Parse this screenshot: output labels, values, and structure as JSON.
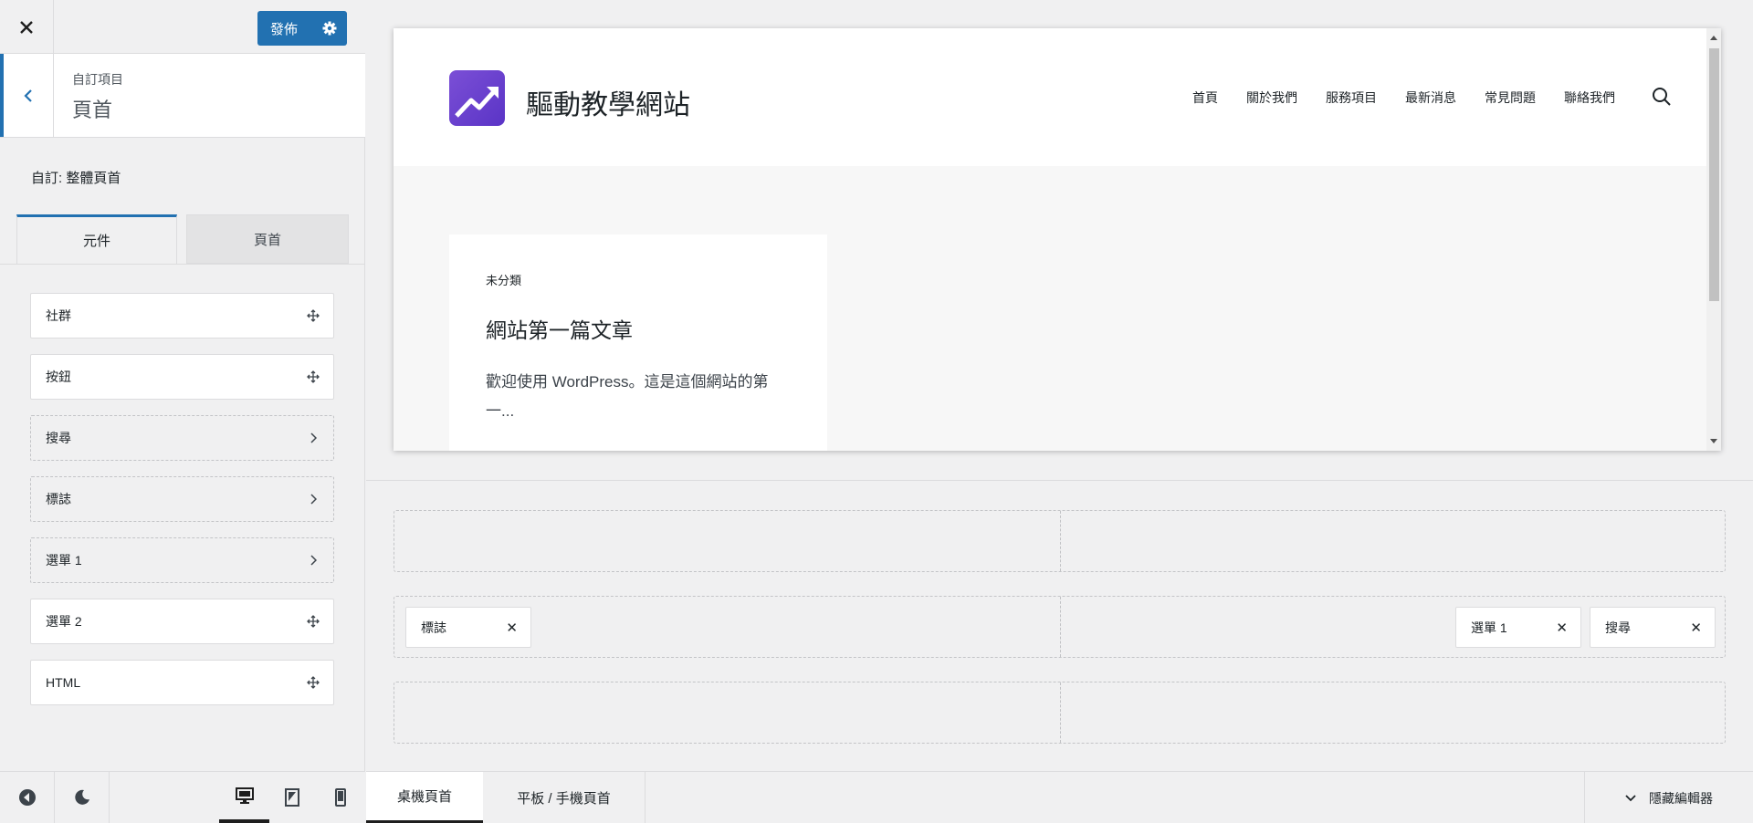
{
  "topbar": {
    "close_icon": "close-icon",
    "publish_label": "發佈"
  },
  "section": {
    "crumb_small": "自訂項目",
    "crumb_title": "頁首"
  },
  "custom_title": "自訂: 整體頁首",
  "tabs": [
    {
      "label": "元件"
    },
    {
      "label": "頁首"
    }
  ],
  "elements": [
    {
      "label": "社群",
      "icon": "move-icon",
      "style": "solid"
    },
    {
      "label": "按鈕",
      "icon": "move-icon",
      "style": "solid"
    },
    {
      "label": "搜尋",
      "icon": "chevron-right-icon",
      "style": "dashed"
    },
    {
      "label": "標誌",
      "icon": "chevron-right-icon",
      "style": "dashed"
    },
    {
      "label": "選單 1",
      "icon": "chevron-right-icon",
      "style": "dashed"
    },
    {
      "label": "選單 2",
      "icon": "move-icon",
      "style": "solid"
    },
    {
      "label": "HTML",
      "icon": "move-icon",
      "style": "solid"
    }
  ],
  "preview": {
    "site_name": "驅動教學網站",
    "nav": [
      "首頁",
      "關於我們",
      "服務項目",
      "最新消息",
      "常見問題",
      "聯絡我們"
    ],
    "post": {
      "category": "未分類",
      "title": "網站第一篇文章",
      "excerpt": "歡迎使用 WordPress。這是這個網站的第一..."
    }
  },
  "builder": {
    "main_row_left": [
      {
        "label": "標誌"
      }
    ],
    "main_row_right": [
      {
        "label": "選單 1"
      },
      {
        "label": "搜尋"
      }
    ]
  },
  "footer": {
    "desktop_tab": "桌機頁首",
    "mobile_tab": "平板 / 手機頁首",
    "hide_label": "隱藏編輯器"
  },
  "colors": {
    "accent": "#2271b1",
    "logo": "#6a40d0",
    "background": "#f0f0f1"
  }
}
